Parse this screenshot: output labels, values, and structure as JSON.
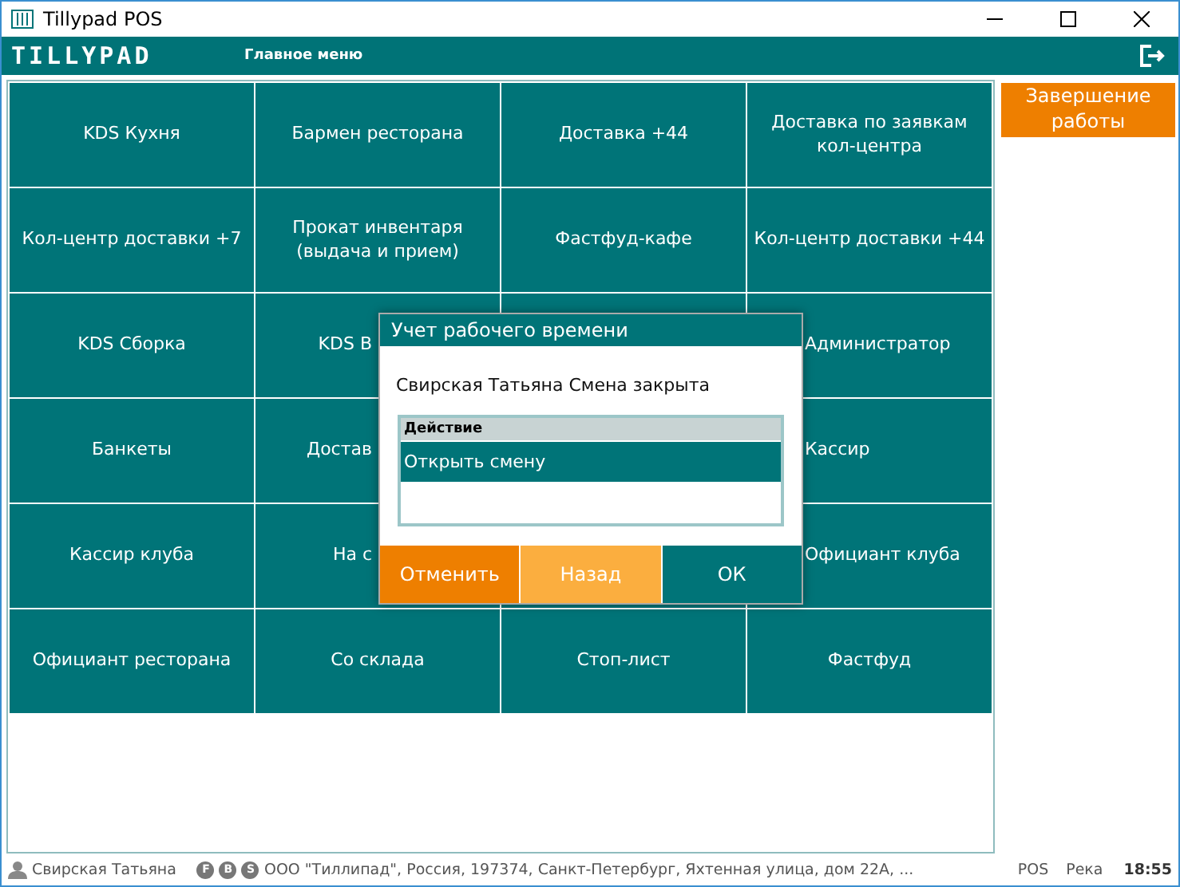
{
  "window": {
    "title": "Tillypad POS"
  },
  "header": {
    "logo": "TILLYPAD",
    "title": "Главное меню"
  },
  "tiles": [
    "KDS Кухня",
    "Бармен ресторана",
    "Доставка +44",
    "Доставка по заявкам кол-центра",
    "Кол-центр доставки +7",
    "Прокат инвентаря (выдача и прием)",
    "Фастфуд-кафе",
    "Кол-центр доставки +44",
    "KDS Сборка",
    "KDS В",
    "Администратор",
    "Банкеты",
    "Достав",
    "Кассир",
    "Кассир клуба",
    "На с",
    "Официант клуба",
    "Официант ресторана",
    "Со склада",
    "Стоп-лист",
    "Фастфуд"
  ],
  "side_button": "Завершение работы",
  "dialog": {
    "title": "Учет рабочего времени",
    "message": "Свирская Татьяна Смена закрыта",
    "list": {
      "header": "Действие",
      "rows": [
        {
          "label": "Открыть смену",
          "selected": true
        }
      ]
    },
    "buttons": [
      {
        "label": "Отменить",
        "kind": "cancel"
      },
      {
        "label": "Назад",
        "kind": "back"
      },
      {
        "label": "ОК",
        "kind": "ok"
      }
    ]
  },
  "status_bar": {
    "user": "Свирская Татьяна",
    "badges": [
      "F",
      "B",
      "S"
    ],
    "company": "ООО \"Тиллипад\", Россия, 197374, Санкт-Петербург, Яхтенная улица, дом 22А, ...",
    "mode": "POS",
    "place": "Река",
    "time": "18:55"
  }
}
